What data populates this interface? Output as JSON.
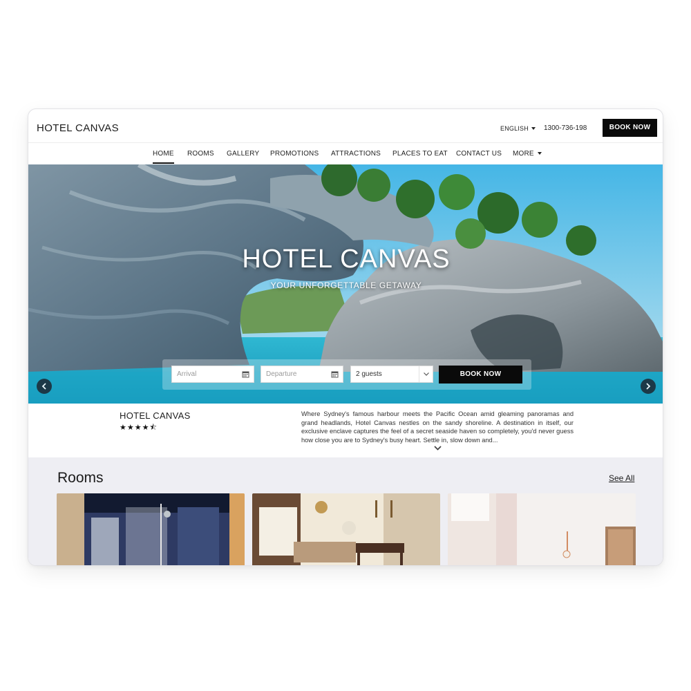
{
  "header": {
    "logo": "HOTEL CANVAS",
    "language": "ENGLISH",
    "phone": "1300-736-198",
    "book_now": "BOOK NOW"
  },
  "nav": {
    "items": [
      {
        "label": "HOME",
        "active": true
      },
      {
        "label": "ROOMS"
      },
      {
        "label": "GALLERY"
      },
      {
        "label": "PROMOTIONS"
      },
      {
        "label": "ATTRACTIONS"
      },
      {
        "label": "PLACES TO EAT"
      },
      {
        "label": "CONTACT US"
      },
      {
        "label": "MORE"
      }
    ]
  },
  "hero": {
    "title": "HOTEL CANVAS",
    "subtitle": "YOUR UNFORGETTABLE GETAWAY",
    "booking": {
      "arrival_placeholder": "Arrival",
      "departure_placeholder": "Departure",
      "guests_value": "2 guests",
      "book_now": "BOOK NOW"
    }
  },
  "info": {
    "name": "HOTEL CANVAS",
    "rating": 4.5,
    "stars_text": "★★★★⯪",
    "description": "Where Sydney's famous harbour meets the Pacific Ocean amid gleaming panoramas and grand headlands, Hotel Canvas nestles on the sandy shoreline. A destination in itself, our exclusive enclave captures the feel of a secret seaside haven so completely, you'd never guess how close you are to Sydney's busy heart. Settle in, slow down and..."
  },
  "rooms": {
    "title": "Rooms",
    "see_all": "See All"
  },
  "colors": {
    "accent": "#0a0a0a",
    "rooms_background": "#eeeef3",
    "sea": "#22b6cf"
  }
}
